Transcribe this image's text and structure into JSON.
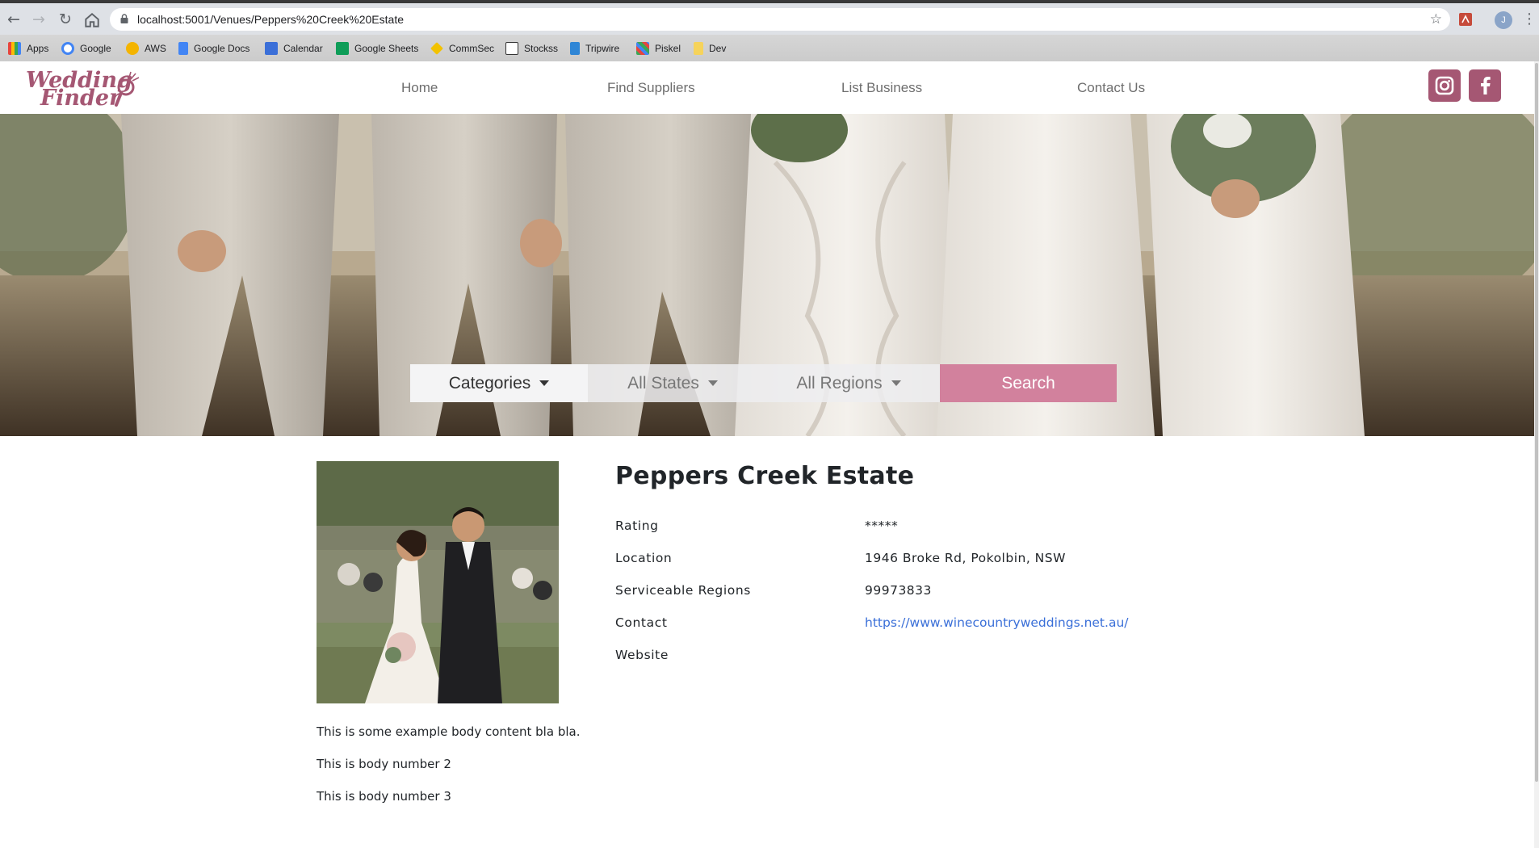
{
  "browser": {
    "url": "localhost:5001/Venues/Peppers%20Creek%20Estate",
    "profile_initial": "J",
    "bookmarks": [
      {
        "label": "Apps",
        "icon": "apps-grid-icon",
        "color": "#e8453c"
      },
      {
        "label": "Google",
        "icon": "google-icon",
        "color": "#4285f4"
      },
      {
        "label": "AWS",
        "icon": "aws-icon",
        "color": "#f4b400"
      },
      {
        "label": "Google Docs",
        "icon": "google-docs-icon",
        "color": "#4285f4"
      },
      {
        "label": "Calendar",
        "icon": "calendar-icon",
        "color": "#3b6fd8"
      },
      {
        "label": "Google Sheets",
        "icon": "google-sheets-icon",
        "color": "#0f9d58"
      },
      {
        "label": "CommSec",
        "icon": "commsec-icon",
        "color": "#f2c200"
      },
      {
        "label": "Stockss",
        "icon": "stocks-icon",
        "color": "#333333"
      },
      {
        "label": "Tripwire",
        "icon": "tripwire-icon",
        "color": "#2f86d6"
      },
      {
        "label": "Piskel",
        "icon": "piskel-icon",
        "color": "#3aa757"
      },
      {
        "label": "Dev",
        "icon": "folder-icon",
        "color": "#f6d35b"
      }
    ]
  },
  "site": {
    "brand_line1": "Wedding",
    "brand_line2": "Finder",
    "brand_color": "#a55773",
    "nav": [
      "Home",
      "Find Suppliers",
      "List Business",
      "Contact Us"
    ],
    "social": [
      {
        "name": "instagram",
        "icon": "instagram-icon"
      },
      {
        "name": "facebook",
        "icon": "facebook-icon"
      }
    ]
  },
  "search": {
    "categories_label": "Categories",
    "states_label": "All States",
    "regions_label": "All Regions",
    "search_label": "Search",
    "accent_color": "#d2819d"
  },
  "venue": {
    "title": "Peppers Creek Estate",
    "details": [
      {
        "label": "Rating",
        "value": "*****"
      },
      {
        "label": "Location",
        "value": "1946 Broke Rd, Pokolbin, NSW"
      },
      {
        "label": "Serviceable Regions",
        "value": "99973833"
      },
      {
        "label": "Contact",
        "value": "https://www.winecountryweddings.net.au/"
      },
      {
        "label": "Website",
        "value": ""
      }
    ],
    "body": [
      "This is some example body content bla bla.",
      "This is body number 2",
      "This is body number 3"
    ]
  }
}
